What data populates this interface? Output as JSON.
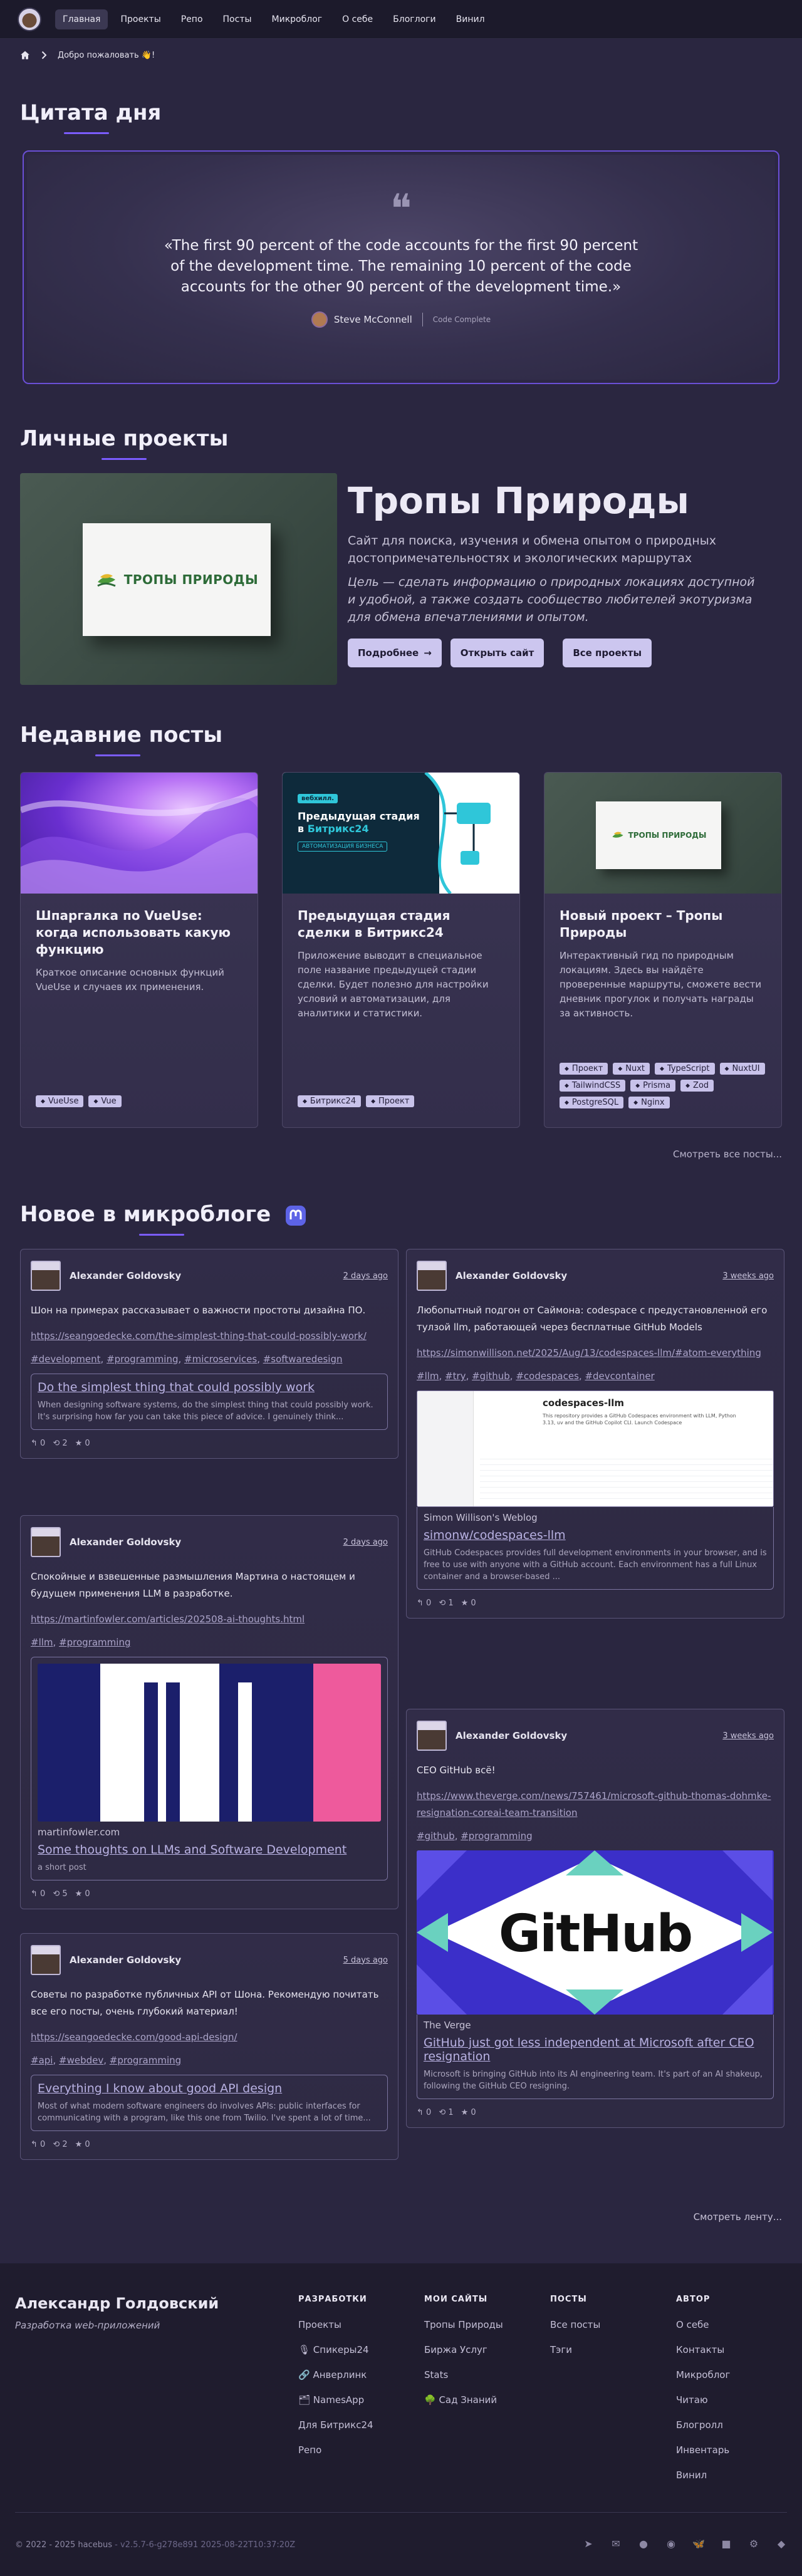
{
  "nav": {
    "items": [
      "Главная",
      "Проекты",
      "Репо",
      "Посты",
      "Микроблог",
      "О себе",
      "Блоглоги",
      "Винил"
    ]
  },
  "breadcrumb": {
    "current": "Добро пожаловать 👋!"
  },
  "quote": {
    "section_title": "Цитата дня",
    "text": "«The first 90 percent of the code accounts for the first 90 percent of the development time. The remaining 10 percent of the code accounts for the other 90 percent of the development time.»",
    "author": "Steve McConnell",
    "source": "Code Complete"
  },
  "project": {
    "section_title": "Личные проекты",
    "logo_text": "ТРОПЫ ПРИРОДЫ",
    "title": "Тропы Природы",
    "description": "Сайт для поиска, изучения и обмена опытом о природных достопримечательностях и экологических маршрутах",
    "goal": "Цель — сделать информацию о природных локациях доступной и удобной, а также создать сообщество любителей экотуризма для обмена впечатлениями и опытом.",
    "btn_more": "Подробнее",
    "btn_open": "Открыть сайт",
    "btn_all": "Все проекты"
  },
  "posts": {
    "section_title": "Недавние посты",
    "see_all": "Смотреть все посты...",
    "items": [
      {
        "title": "Шпаргалка по VueUse: когда использовать какую функцию",
        "desc": "Краткое описание основных функций VueUse и случаев их применения.",
        "tags": [
          "VueUse",
          "Vue"
        ]
      },
      {
        "title": "Предыдущая стадия сделки в Битрикс24",
        "desc": "Приложение выводит в специальное поле название предыдущей стадии сделки. Будет полезно для настройки условий и автоматизации, для аналитики и статистики.",
        "tags": [
          "Битрикс24",
          "Проект"
        ],
        "thumb_badge": "вебхилл.",
        "thumb_title_1": "Предыдущая стадия",
        "thumb_title_2": "в ",
        "thumb_title_3": "Битрикс24",
        "thumb_sub": "АВТОМАТИЗАЦИЯ БИЗНЕСА"
      },
      {
        "title": "Новый проект – Тропы Природы",
        "desc": "Интерактивный гид по природным локациям. Здесь вы найдёте проверенные маршруты, сможете вести дневник прогулок и получать награды за активность.",
        "tags": [
          "Проект",
          "Nuxt",
          "TypeScript",
          "NuxtUI",
          "TailwindCSS",
          "Prisma",
          "Zod",
          "PostgreSQL",
          "Nginx"
        ],
        "thumb_logo": "ТРОПЫ ПРИРОДЫ"
      }
    ]
  },
  "microblog": {
    "section_title": "Новое в микроблоге",
    "see_more": "Смотреть ленту...",
    "toots": [
      {
        "author": "Alexander Goldovsky",
        "date": "2 days ago",
        "text": "Шон на примерах рассказывает о важности простоты дизайна ПО.",
        "link": "https://seangoedecke.com/the-simplest-thing-that-could-possibly-work/",
        "tags": [
          "#development",
          "#programming",
          "#microservices",
          "#softwaredesign"
        ],
        "card_title": "Do the simplest thing that could possibly work",
        "card_desc": "When designing software systems, do the simplest thing that could possibly work. It's surprising how far you can take this piece of advice. I genuinely think...",
        "stats": [
          "0",
          "2",
          "0"
        ]
      },
      {
        "author": "Alexander Goldovsky",
        "date": "2 days ago",
        "text": "Спокойные и взвешенные размышления Мартина о настоящем и будущем применения LLM в разработке.",
        "link": "https://martinfowler.com/articles/202508-ai-thoughts.html",
        "tags": [
          "#llm",
          "#programming"
        ],
        "card_site": "martinfowler.com",
        "card_title": "Some thoughts on LLMs and Software Development",
        "card_desc": "a short post",
        "stats": [
          "0",
          "5",
          "0"
        ]
      },
      {
        "author": "Alexander Goldovsky",
        "date": "5 days ago",
        "text": "Советы по разработке публичных API от Шона. Рекомендую почитать все его посты, очень глубокий материал!",
        "link": "https://seangoedecke.com/good-api-design/",
        "tags": [
          "#api",
          "#webdev",
          "#programming"
        ],
        "card_title": "Everything I know about good API design",
        "card_desc": "Most of what modern software engineers do involves APIs: public interfaces for communicating with a program, like this one from Twilio. I've spent a lot of time...",
        "stats": [
          "0",
          "2",
          "0"
        ]
      },
      {
        "author": "Alexander Goldovsky",
        "date": "3 weeks ago",
        "text": "Любопытный подгон от Саймона: codespace с предустановленной его тулзой llm, работающей через бесплатные GitHub Models",
        "link": "https://simonwillison.net/2025/Aug/13/codespaces-llm/#atom-everything",
        "tags": [
          "#llm",
          "#try",
          "#github",
          "#codespaces",
          "#devcontainer"
        ],
        "card_site": "Simon Willison's Weblog",
        "card_title": "simonw/codespaces-llm",
        "card_desc": "GitHub Codespaces provides full development environments in your browser, and is free to use with anyone with a GitHub account. Each environment has a full Linux container and a browser-based ...",
        "shot_title": "codespaces-llm",
        "shot_line": "This repository provides a GitHub Codespaces environment with LLM, Python 3.13, uv and the GitHub Copilot CLI. Launch Codespace",
        "stats": [
          "0",
          "1",
          "0"
        ]
      },
      {
        "author": "Alexander Goldovsky",
        "date": "3 weeks ago",
        "text": "CEO GitHub всё!",
        "link": "https://www.theverge.com/news/757461/microsoft-github-thomas-dohmke-resignation-coreai-team-transition",
        "tags": [
          "#github",
          "#programming"
        ],
        "card_site": "The Verge",
        "card_image_text": "GitHub",
        "card_title": "GitHub just got less independent at Microsoft after CEO resignation",
        "card_desc": "Microsoft is bringing GitHub into its AI engineering team. It's part of an AI shakeup, following the GitHub CEO resigning.",
        "stats": [
          "0",
          "1",
          "0"
        ]
      }
    ]
  },
  "footer": {
    "name": "Александр Голдовский",
    "subtitle": "Разработка web-приложений",
    "cols": [
      {
        "head": "РАЗРАБОТКИ",
        "links": [
          "Проекты",
          "🎙 Спикеры24",
          "🔗 Анверлинк",
          "🗂 NamesApp",
          "Для Битрикс24",
          "Репо"
        ]
      },
      {
        "head": "МОИ САЙТЫ",
        "links": [
          "Тропы Природы",
          "Биржа Услуг",
          "Stats",
          "🌳 Сад Знаний"
        ]
      },
      {
        "head": "ПОСТЫ",
        "links": [
          "Все посты",
          "Тэги"
        ]
      },
      {
        "head": "АВТОР",
        "links": [
          "О себе",
          "Контакты",
          "Микроблог",
          "Читаю",
          "Блогролл",
          "Инвентарь",
          "Винил"
        ]
      }
    ],
    "copyright": "© 2022 - 2025 hacebus",
    "version": "- v2.5.7-6-g278e891 2025-08-22T10:37:20Z",
    "social": [
      "telegram-icon",
      "mail-icon",
      "github-icon",
      "mastodon-icon",
      "bluesky-icon",
      "vk-icon",
      "steam-icon",
      "telegram-channel-icon"
    ]
  }
}
